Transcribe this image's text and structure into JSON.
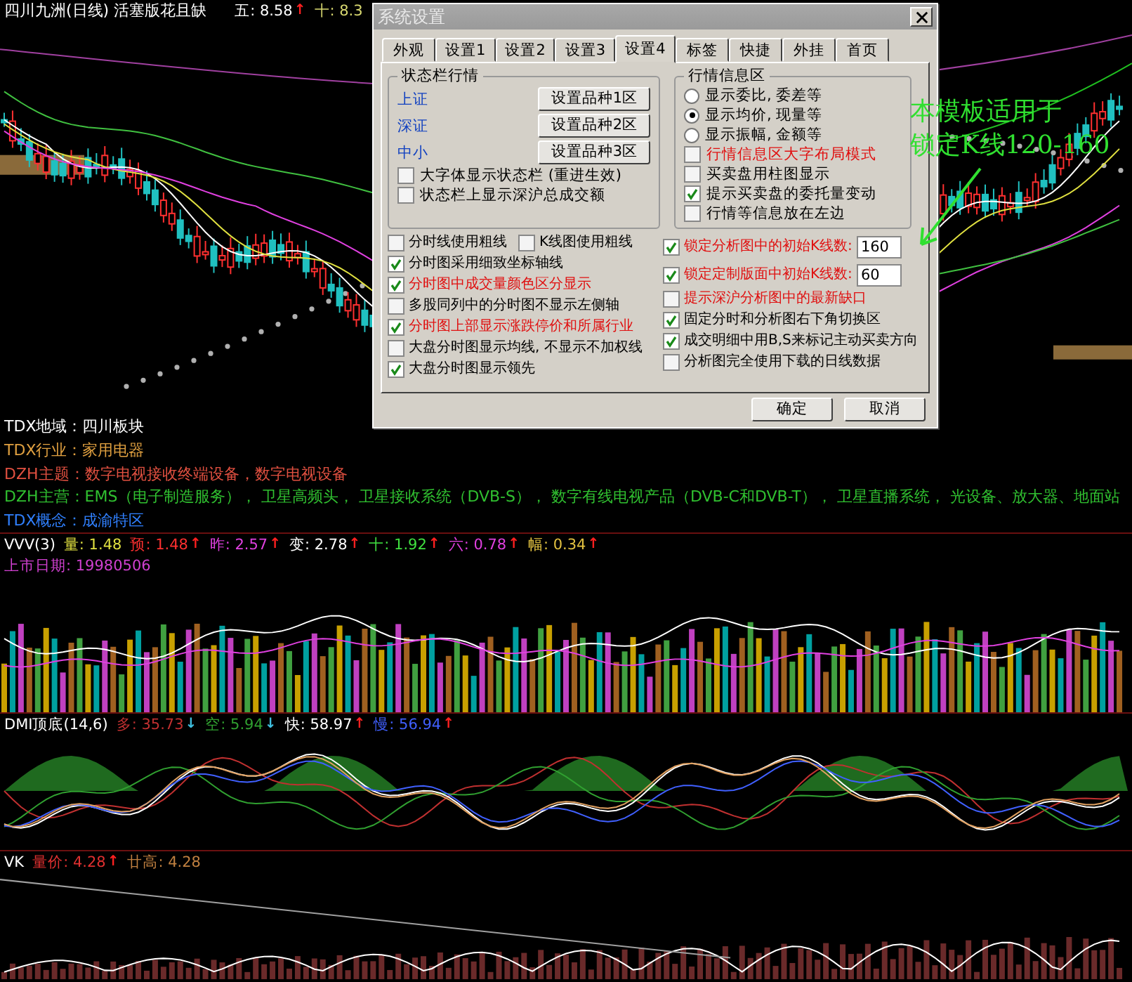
{
  "chart_header": {
    "title": "四川九洲(日线) 活塞版花且缺",
    "values": [
      {
        "label": "五:",
        "value": "8.58",
        "color": "#ffffff",
        "arrow": {
          "glyph": "↑",
          "color": "#ff2020"
        }
      },
      {
        "label": "十:",
        "value": "8.3",
        "color": "#d8d870"
      }
    ]
  },
  "info_lines": [
    {
      "text": "TDX地域：四川板块",
      "color": "#ffffff"
    },
    {
      "text": "TDX行业：家用电器",
      "color": "#e0a040"
    },
    {
      "text": "DZH主题：数字电视接收终端设备，数字电视设备",
      "color": "#e05040"
    },
    {
      "text": "DZH主营：EMS（电子制造服务）， 卫星高频头， 卫星接收系统（DVB-S）， 数字有线电视产品（DVB-C和DVB-T）， 卫星直播系统， 光设备、放大器、地面站",
      "color": "#30c030"
    },
    {
      "text": "TDX概念：成渝特区",
      "color": "#3080ff"
    }
  ],
  "volume_panel": {
    "name": "VVV(3)",
    "values": [
      {
        "label": "量:",
        "value": "1.48",
        "color": "#e0e040"
      },
      {
        "label": "预:",
        "value": "1.48",
        "color": "#ff3030",
        "arrow": {
          "glyph": "↑",
          "color": "#ff2020"
        }
      },
      {
        "label": "昨:",
        "value": "2.57",
        "color": "#e040e0",
        "arrow": {
          "glyph": "↑",
          "color": "#ff2020"
        }
      },
      {
        "label": "变:",
        "value": "2.78",
        "color": "#ffffff",
        "arrow": {
          "glyph": "↑",
          "color": "#ff2020"
        }
      },
      {
        "label": "十:",
        "value": "1.92",
        "color": "#40e040",
        "arrow": {
          "glyph": "↑",
          "color": "#ff2020"
        }
      },
      {
        "label": "六:",
        "value": "0.78",
        "color": "#e040e0",
        "arrow": {
          "glyph": "↑",
          "color": "#ff2020"
        }
      },
      {
        "label": "幅:",
        "value": "0.34",
        "color": "#e0c040",
        "arrow": {
          "glyph": "↑",
          "color": "#ff2020"
        }
      }
    ],
    "listing_date": "上市日期: 19980506"
  },
  "dmi_panel": {
    "name": "DMI顶底(14,6)",
    "values": [
      {
        "label": "多:",
        "value": "35.73",
        "color": "#c03030",
        "arrow": {
          "glyph": "↓",
          "color": "#40c0e0"
        }
      },
      {
        "label": "空:",
        "value": "5.94",
        "color": "#30a030",
        "arrow": {
          "glyph": "↓",
          "color": "#40c0e0"
        }
      },
      {
        "label": "快:",
        "value": "58.97",
        "color": "#ffffff",
        "arrow": {
          "glyph": "↑",
          "color": "#ff2020"
        }
      },
      {
        "label": "慢:",
        "value": "56.94",
        "color": "#4060ff",
        "arrow": {
          "glyph": "↑",
          "color": "#ff2020"
        }
      }
    ]
  },
  "vk_panel": {
    "name": "VK",
    "values": [
      {
        "label": "量价:",
        "value": "4.28",
        "color": "#e03030",
        "arrow": {
          "glyph": "↑",
          "color": "#ff2020"
        }
      },
      {
        "label": "廿高:",
        "value": "4.28",
        "color": "#c08040"
      }
    ]
  },
  "annotation": {
    "lines": [
      "本模板适用于",
      "锁定K线120-160"
    ]
  },
  "dialog": {
    "title": "系统设置",
    "tabs": [
      {
        "label": "外观",
        "selected": false
      },
      {
        "label": "设置1",
        "selected": false
      },
      {
        "label": "设置2",
        "selected": false
      },
      {
        "label": "设置3",
        "selected": false
      },
      {
        "label": "设置4",
        "selected": true
      },
      {
        "label": "标签",
        "selected": false
      },
      {
        "label": "快捷",
        "selected": false
      },
      {
        "label": "外挂",
        "selected": false
      },
      {
        "label": "首页",
        "selected": false
      }
    ],
    "status_group": {
      "title": "状态栏行情",
      "rows": [
        {
          "label": "上证",
          "button": "设置品种1区"
        },
        {
          "label": "深证",
          "button": "设置品种2区"
        },
        {
          "label": "中小",
          "button": "设置品种3区"
        }
      ],
      "options": [
        {
          "label": "大字体显示状态栏 (重进生效)",
          "checked": false
        },
        {
          "label": "状态栏上显示深沪总成交额",
          "checked": false
        }
      ]
    },
    "quote_group": {
      "title": "行情信息区",
      "radios": [
        {
          "label": "显示委比, 委差等",
          "selected": false
        },
        {
          "label": "显示均价, 现量等",
          "selected": true
        },
        {
          "label": "显示振幅, 金额等",
          "selected": false
        }
      ],
      "options": [
        {
          "label": "行情信息区大字布局模式",
          "checked": false,
          "emphasis": true
        },
        {
          "label": "买卖盘用柱图显示",
          "checked": false,
          "emphasis": false
        },
        {
          "label": "提示买卖盘的委托量变动",
          "checked": true,
          "emphasis": false
        },
        {
          "label": "行情等信息放在左边",
          "checked": false,
          "emphasis": false
        }
      ]
    },
    "left_rows": [
      [
        {
          "label": "分时线使用粗线",
          "checked": false,
          "emphasis": false
        },
        {
          "label": "K线图使用粗线",
          "checked": false,
          "emphasis": false
        }
      ],
      [
        {
          "label": "分时图采用细致坐标轴线",
          "checked": true,
          "emphasis": false
        }
      ],
      [
        {
          "label": "分时图中成交量颜色区分显示",
          "checked": true,
          "emphasis": true
        }
      ],
      [
        {
          "label": "多股同列中的分时图不显示左侧轴",
          "checked": false,
          "emphasis": false
        }
      ],
      [
        {
          "label": "分时图上部显示涨跌停价和所属行业",
          "checked": true,
          "emphasis": true
        }
      ],
      [
        {
          "label": "大盘分时图显示均线, 不显示不加权线",
          "checked": false,
          "emphasis": false
        }
      ],
      [
        {
          "label": "大盘分时图显示领先",
          "checked": true,
          "emphasis": false
        }
      ]
    ],
    "right_rows": [
      {
        "kind": "field",
        "label": "锁定分析图中的初始K线数:",
        "checked": true,
        "emphasis": true,
        "value": "160"
      },
      {
        "kind": "field",
        "label": "锁定定制版面中初始K线数:",
        "checked": true,
        "emphasis": true,
        "value": "60"
      },
      {
        "kind": "check",
        "label": "提示深沪分析图中的最新缺口",
        "checked": false,
        "emphasis": true
      },
      {
        "kind": "check",
        "label": "固定分时和分析图右下角切换区",
        "checked": true,
        "emphasis": false
      },
      {
        "kind": "check",
        "label": "成交明细中用B,S来标记主动买卖方向",
        "checked": true,
        "emphasis": false
      },
      {
        "kind": "check",
        "label": "分析图完全使用下载的日线数据",
        "checked": false,
        "emphasis": false
      }
    ],
    "buttons": [
      "确定",
      "取消"
    ]
  }
}
